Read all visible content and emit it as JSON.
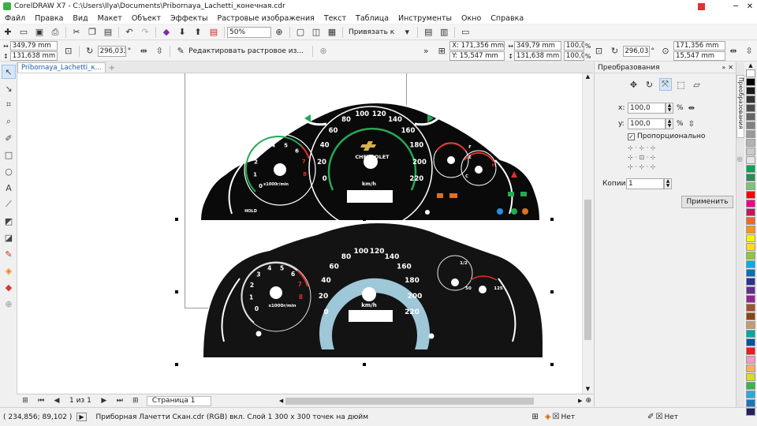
{
  "titlebar": {
    "title": "CorelDRAW X7 - C:\\Users\\Ilya\\Documents\\Pribornaya_Lachetti_конечная.cdr",
    "minimize": "─",
    "close": "✕"
  },
  "menu": [
    "Файл",
    "Правка",
    "Вид",
    "Макет",
    "Объект",
    "Эффекты",
    "Растровые изображения",
    "Текст",
    "Таблица",
    "Инструменты",
    "Окно",
    "Справка"
  ],
  "standard": {
    "zoom": "50%",
    "snap_label": "Привязать к"
  },
  "property": {
    "x_left": "349,79 mm",
    "y_left": "131,638 mm",
    "angle_left": "296,033",
    "angle_unit": "°",
    "edit_bitmap": "Редактировать растровое из...",
    "x": "X: 171,356 mm",
    "y": "Y: 15,547 mm",
    "w": "349,79 mm",
    "h": "131,638 mm",
    "scale_w": "100,0",
    "scale_h": "100,0",
    "pct": "%",
    "angle": "296,033",
    "ox": "171,356 mm",
    "oy": "15,547 mm"
  },
  "doc_tab": "Pribornaya_Lachetti_к...",
  "top_gauge": {
    "speed_ticks": [
      "0",
      "20",
      "40",
      "60",
      "80",
      "100",
      "120",
      "140",
      "160",
      "180",
      "200",
      "220"
    ],
    "rpm_ticks": [
      "0",
      "1",
      "2",
      "3",
      "4",
      "5",
      "6",
      "7",
      "8"
    ],
    "brand": "CHEVROLET",
    "speed_unit": "km/h",
    "rpm_unit": "x1000r/min",
    "hold": "HOLD",
    "fuel_e": "E",
    "fuel_f": "F",
    "temp_c": "C",
    "temp_h": "H"
  },
  "bottom_gauge": {
    "speed_ticks": [
      "0",
      "20",
      "40",
      "60",
      "80",
      "100",
      "120",
      "140",
      "160",
      "180",
      "200",
      "220"
    ],
    "rpm_ticks": [
      "0",
      "1",
      "2",
      "3",
      "4",
      "5",
      "6",
      "7",
      "8"
    ],
    "speed_unit": "km/h",
    "rpm_unit": "x1000r/min",
    "fuel_half": "1/2",
    "temp_low": "50",
    "temp_high": "125"
  },
  "bottom": {
    "page_of": "1 из 1",
    "page_tab": "Страница 1"
  },
  "status": {
    "coords": "( 234,856; 89,102 )",
    "info": "Приборная Лачетти Скан.cdr (RGB) вкл. Слой 1 300 x 300 точек на дюйм",
    "fill_none": "Нет",
    "outline_none": "Нет"
  },
  "docker": {
    "title": "Преобразования",
    "x_label": "x:",
    "x_val": "100,0",
    "y_label": "y:",
    "y_val": "100,0",
    "pct": "%",
    "proportional": "Пропорционально",
    "copies_label": "Копии:",
    "copies_val": "1",
    "apply": "Применить",
    "side_tab": "Преобразования"
  },
  "palette_colors": [
    "#ffffff",
    "#000000",
    "#1a1a1a",
    "#333333",
    "#4d4d4d",
    "#666666",
    "#808080",
    "#999999",
    "#b3b3b3",
    "#cccccc",
    "#e6e6e6",
    "#00a651",
    "#2e8b57",
    "#7cc576",
    "#ff0000",
    "#ec008c",
    "#c2185b",
    "#f26522",
    "#f7941d",
    "#fff200",
    "#ffde17",
    "#8dc63f",
    "#00aeef",
    "#0072bc",
    "#2e3192",
    "#662d91",
    "#92278f",
    "#a0522d",
    "#8b4513",
    "#c69c6d",
    "#00a99d",
    "#0054a6",
    "#ed1c24",
    "#f49ac1",
    "#fbaf5d",
    "#d7df23",
    "#39b54a",
    "#27aae1",
    "#1b75bb",
    "#262262"
  ],
  "colors": {
    "accent": "#1a5aa8",
    "gauge_green": "#22aa55",
    "gauge_red": "#e0312b",
    "scan_blue": "#9ec7d8"
  }
}
